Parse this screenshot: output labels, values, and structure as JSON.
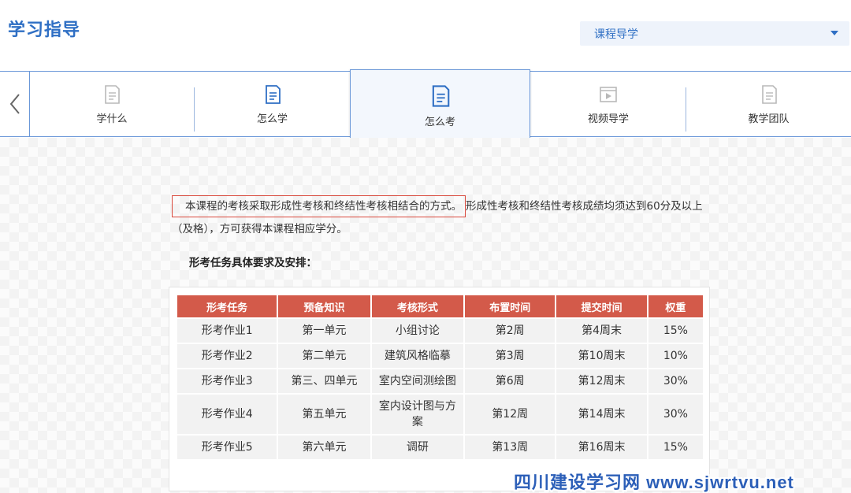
{
  "page": {
    "title": "学习指导"
  },
  "course_select": {
    "value": "课程导学"
  },
  "tabs": [
    {
      "label": "学什么",
      "icon": "doc-icon"
    },
    {
      "label": "怎么学",
      "icon": "doc-icon"
    },
    {
      "label": "怎么考",
      "icon": "doc-icon",
      "active": true
    },
    {
      "label": "视频导学",
      "icon": "video-icon"
    },
    {
      "label": "教学团队",
      "icon": "doc-icon"
    }
  ],
  "intro": {
    "highlighted": "本课程的考核采取形成性考核和终结性考核相结合的方式。",
    "rest": "形成性考核和终结性考核成绩均须达到60分及以上（及格），方可获得本课程相应学分。"
  },
  "subhead": "形考任务具体要求及安排：",
  "table": {
    "headers": [
      "形考任务",
      "预备知识",
      "考核形式",
      "布置时间",
      "提交时间",
      "权重"
    ],
    "rows": [
      [
        "形考作业1",
        "第一单元",
        "小组讨论",
        "第2周",
        "第4周末",
        "15%"
      ],
      [
        "形考作业2",
        "第二单元",
        "建筑风格临摹",
        "第3周",
        "第10周末",
        "10%"
      ],
      [
        "形考作业3",
        "第三、四单元",
        "室内空间测绘图",
        "第6周",
        "第12周末",
        "30%"
      ],
      [
        "形考作业4",
        "第五单元",
        "室内设计图与方案",
        "第12周",
        "第14周末",
        "30%"
      ],
      [
        "形考作业5",
        "第六单元",
        "调研",
        "第13周",
        "第16周末",
        "15%"
      ]
    ]
  },
  "watermark": "四川建设学习网 www.sjwrtvu.net",
  "colors": {
    "accent": "#2f6fc4",
    "table_header": "#d35a4a",
    "highlight_border": "#d9483b"
  }
}
